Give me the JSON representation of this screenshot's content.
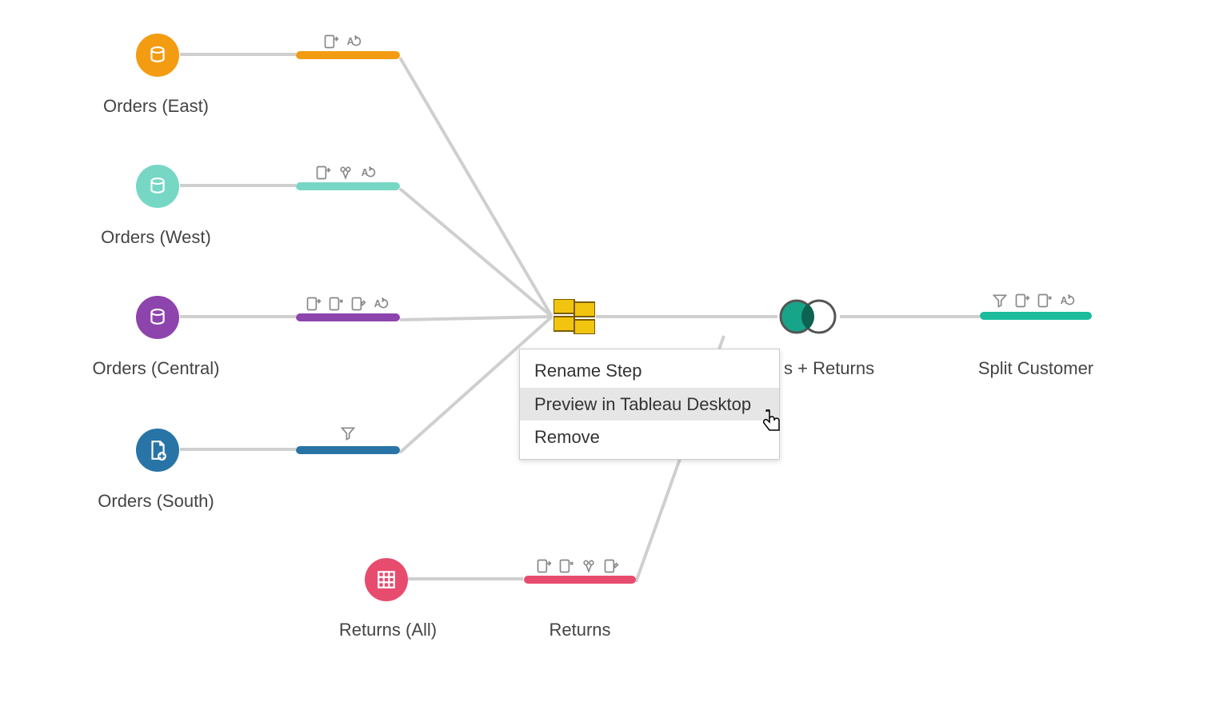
{
  "colors": {
    "orange": "#f39c12",
    "teal": "#76d7c4",
    "tealDark": "#17a589",
    "purple": "#8e44ad",
    "blue": "#2874a6",
    "pink": "#e74c6f",
    "yellow": "#f1c40f",
    "grayIcon": "#888",
    "grayLine": "#cfcfcf",
    "tealBright": "#1abc9c"
  },
  "sources": {
    "east": {
      "label": "Orders (East)"
    },
    "west": {
      "label": "Orders (West)"
    },
    "central": {
      "label": "Orders (Central)"
    },
    "south": {
      "label": "Orders (South)"
    },
    "returns_all": {
      "label": "Returns (All)"
    }
  },
  "steps": {
    "east": {
      "icons": [
        "filter-out",
        "rename"
      ]
    },
    "west": {
      "icons": [
        "filter-out",
        "clip",
        "rename"
      ]
    },
    "central": {
      "icons": [
        "filter-out",
        "remove",
        "edit",
        "rename"
      ]
    },
    "south": {
      "icons": [
        "filter"
      ]
    },
    "returns": {
      "label": "Returns",
      "icons": [
        "filter-out",
        "remove",
        "clip",
        "edit"
      ]
    },
    "union": {},
    "join": {
      "label": "s + Returns"
    },
    "split": {
      "label": "Split Customer",
      "icons": [
        "filter",
        "filter-out",
        "remove",
        "rename"
      ]
    }
  },
  "context_menu": {
    "items": [
      {
        "label": "Rename Step",
        "hovered": false
      },
      {
        "label": "Preview in Tableau Desktop",
        "hovered": true
      },
      {
        "label": "Remove",
        "hovered": false
      }
    ]
  }
}
